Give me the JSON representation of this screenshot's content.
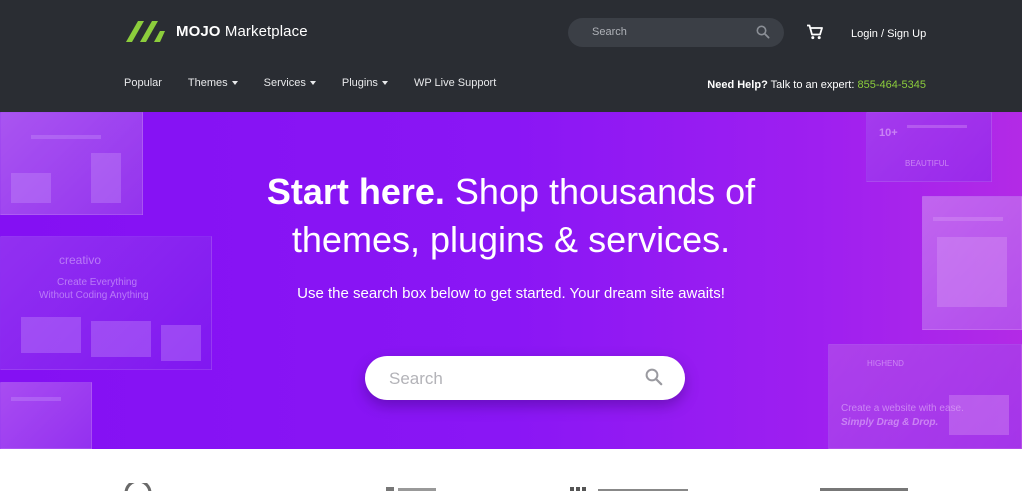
{
  "header": {
    "brand_bold": "MOJO",
    "brand_light": "Marketplace",
    "search_placeholder": "Search",
    "login_label": "Login / Sign Up",
    "icons": [
      "mojo-logo-icon",
      "search-icon",
      "cart-icon"
    ],
    "colors": {
      "background": "#2a2d33",
      "logo_green": "#8ccd3c",
      "phone_green": "#8ccd3c"
    }
  },
  "nav": {
    "items": [
      {
        "label": "Popular",
        "dropdown": false
      },
      {
        "label": "Themes",
        "dropdown": true
      },
      {
        "label": "Services",
        "dropdown": true
      },
      {
        "label": "Plugins",
        "dropdown": true
      },
      {
        "label": "WP Live Support",
        "dropdown": false
      }
    ],
    "help_bold": "Need Help?",
    "help_text": " Talk to an expert: ",
    "help_phone": "855-464-5345"
  },
  "hero": {
    "title_bold": "Start here.",
    "title_rest_line1": " Shop thousands of",
    "title_line2": "themes, plugins & services.",
    "subtitle": "Use the search box below to get started. Your dream site awaits!",
    "search_placeholder": "Search",
    "colors": {
      "gradient_start": "#8410f3",
      "gradient_end": "#b32ae6"
    },
    "thumbnails": {
      "creativo_brand": "creativo",
      "creativo_line1": "Create Everything",
      "creativo_line2": "Without Coding Anything",
      "stat_text": "10+",
      "beautiful_text": "BEAUTIFUL",
      "highend_brand": "HIGHEND",
      "highend_line1": "Create a website with ease.",
      "highend_line2": "Simply Drag & Drop."
    }
  }
}
